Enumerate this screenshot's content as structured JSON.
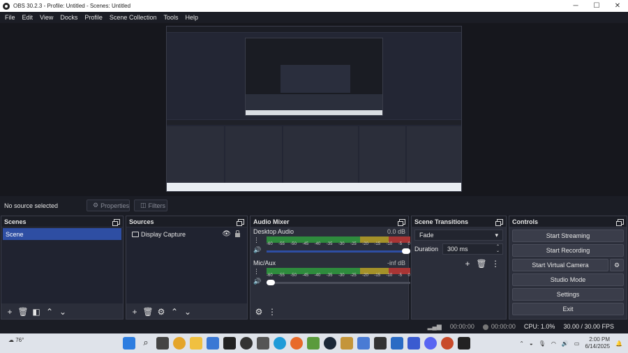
{
  "window": {
    "title": "OBS 30.2.3 - Profile: Untitled - Scenes: Untitled"
  },
  "menu": [
    "File",
    "Edit",
    "View",
    "Docks",
    "Profile",
    "Scene Collection",
    "Tools",
    "Help"
  ],
  "source_bar": {
    "label": "No source selected",
    "properties": "Properties",
    "filters": "Filters"
  },
  "scenes": {
    "title": "Scenes",
    "items": [
      "Scene"
    ]
  },
  "sources": {
    "title": "Sources",
    "items": [
      "Display Capture"
    ]
  },
  "mixer": {
    "title": "Audio Mixer",
    "channels": [
      {
        "name": "Desktop Audio",
        "db": "0.0 dB",
        "level": 0.98
      },
      {
        "name": "Mic/Aux",
        "db": "-inf dB",
        "level": 0.04
      }
    ],
    "ticks": [
      "-60",
      "-55",
      "-50",
      "-45",
      "-40",
      "-35",
      "-30",
      "-25",
      "-20",
      "-15",
      "-10",
      "-5",
      "0"
    ]
  },
  "transitions": {
    "title": "Scene Transitions",
    "type": "Fade",
    "duration_label": "Duration",
    "duration": "300 ms"
  },
  "controls": {
    "title": "Controls",
    "buttons": [
      "Start Streaming",
      "Start Recording",
      "Start Virtual Camera",
      "Studio Mode",
      "Settings",
      "Exit"
    ]
  },
  "status": {
    "stream_time": "00:00:00",
    "rec_time": "00:00:00",
    "cpu": "CPU: 1.0%",
    "fps": "30.00 / 30.00 FPS"
  },
  "taskbar": {
    "weather": "76°",
    "time": "2:00 PM",
    "date": "6/14/2025"
  },
  "colors": {
    "accent": "#2e4ea3",
    "panel": "#2b2e3a",
    "bg": "#1b1d25"
  }
}
